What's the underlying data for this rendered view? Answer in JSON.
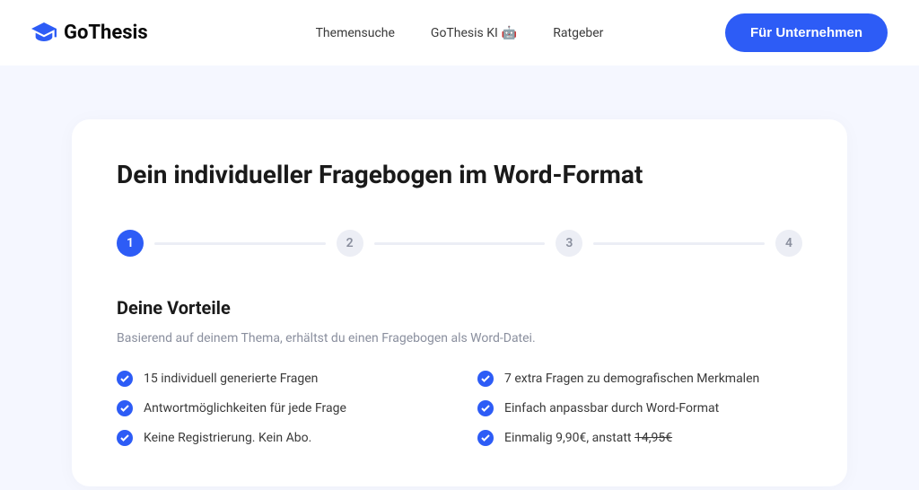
{
  "header": {
    "logo_text": "GoThesis",
    "nav": {
      "themensuche": "Themensuche",
      "gothesis_ki": "GoThesis KI",
      "ratgeber": "Ratgeber"
    },
    "cta": "Für Unternehmen"
  },
  "card": {
    "title": "Dein individueller Fragebogen im Word-Format",
    "steps": {
      "step1": "1",
      "step2": "2",
      "step3": "3",
      "step4": "4"
    },
    "subtitle": "Deine Vorteile",
    "description": "Basierend auf deinem Thema, erhältst du einen Fragebogen als Word-Datei.",
    "benefits": {
      "b1": "15 individuell generierte Fragen",
      "b2": "7 extra Fragen zu demografischen Merkmalen",
      "b3": "Antwortmöglichkeiten für jede Frage",
      "b4": "Einfach anpassbar durch Word-Format",
      "b5": "Keine Registrierung. Kein Abo.",
      "b6_prefix": "Einmalig 9,90€, anstatt ",
      "b6_strike": "14,95€"
    }
  }
}
